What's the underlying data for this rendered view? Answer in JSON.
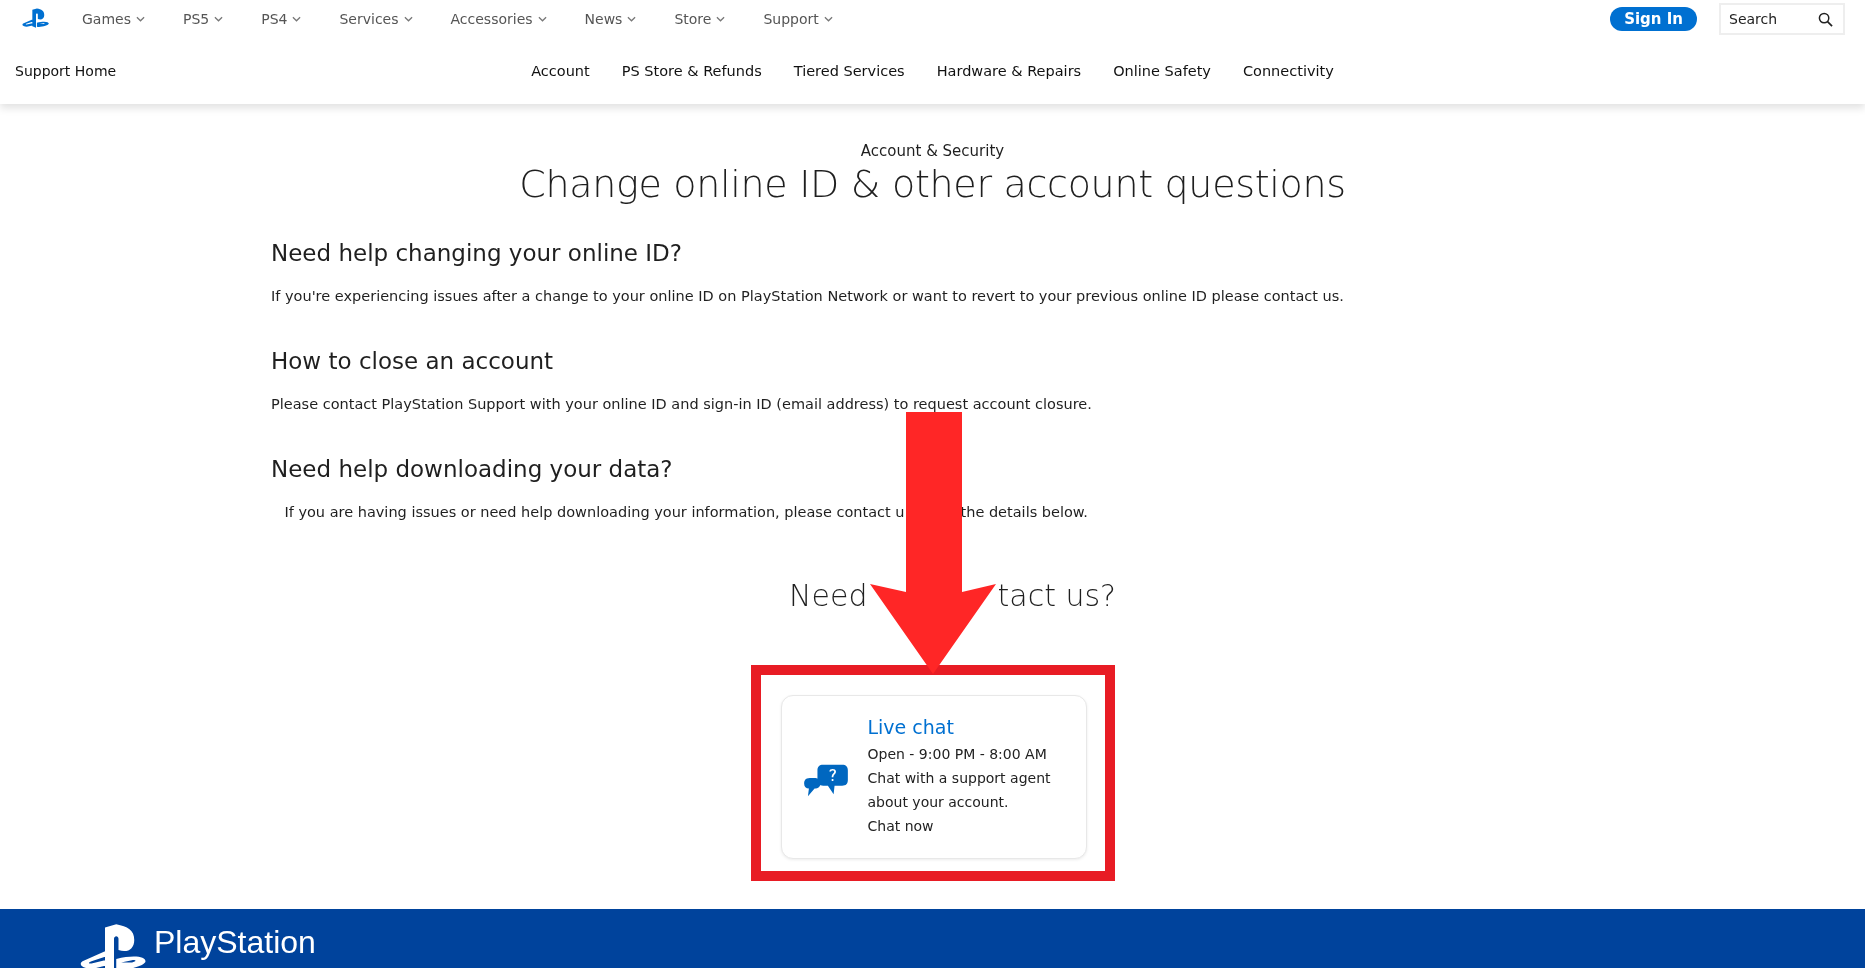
{
  "top_nav": {
    "items": [
      {
        "label": "Games"
      },
      {
        "label": "PS5"
      },
      {
        "label": "PS4"
      },
      {
        "label": "Services"
      },
      {
        "label": "Accessories"
      },
      {
        "label": "News"
      },
      {
        "label": "Store"
      },
      {
        "label": "Support"
      }
    ],
    "sign_in": "Sign In",
    "search": {
      "placeholder": "Search"
    }
  },
  "sub_nav": {
    "home": "Support Home",
    "items": [
      "Account",
      "PS Store & Refunds",
      "Tiered Services",
      "Hardware & Repairs",
      "Online Safety",
      "Connectivity"
    ]
  },
  "breadcrumb": "Account & Security",
  "title": "Change online ID & other account questions",
  "sections": [
    {
      "heading": "Need help changing your online ID?",
      "body": "If you're experiencing issues after a change to your online ID on PlayStation Network or want to revert to your previous online ID please contact us."
    },
    {
      "heading": "How to close an account",
      "body": "Please contact PlayStation Support with your online ID and sign-in ID (email address) to request account closure."
    },
    {
      "heading": "Need help downloading your data?",
      "body_parts": [
        "If you are having issues or need help downloading your information, please contact u",
        "the details below."
      ]
    }
  ],
  "contact": {
    "heading_parts": [
      "Need",
      "tact us?"
    ],
    "card": {
      "title": "Live chat",
      "hours": "Open - 9:00 PM - 8:00 AM",
      "description": "Chat with a support agent about your account.",
      "link": "Chat now"
    }
  },
  "footer": {
    "logo": "PlayStation"
  }
}
